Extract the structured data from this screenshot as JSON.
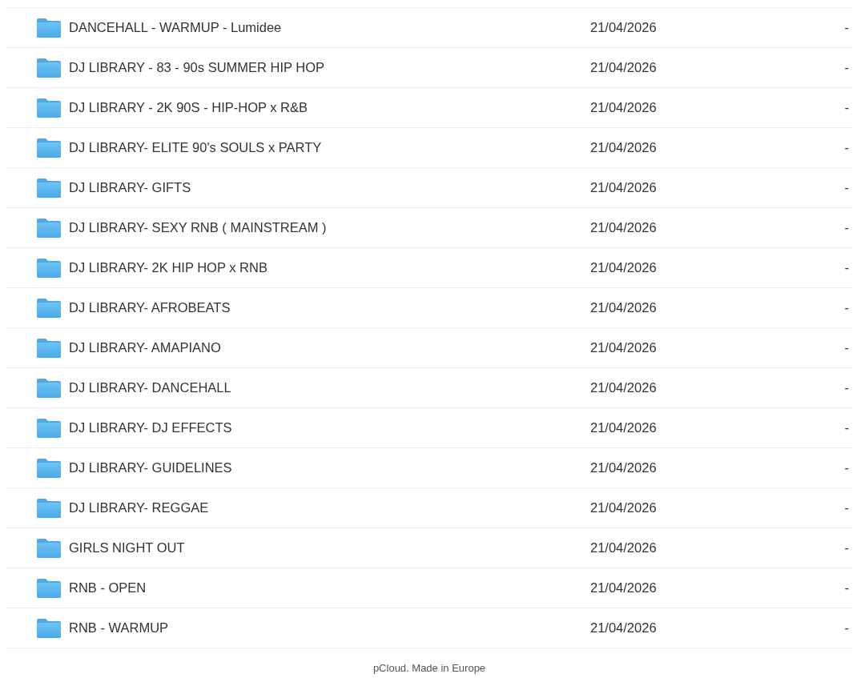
{
  "table": {
    "rows": [
      {
        "name": "DANCEHALL - WARMUP - Lumidee",
        "date": "21/04/2026",
        "column_3": "-"
      },
      {
        "name": "DJ LIBRARY - 83 - 90s SUMMER HIP HOP",
        "date": "21/04/2026",
        "column_3": "-"
      },
      {
        "name": "DJ LIBRARY - 2K 90S - HIP-HOP x R&B",
        "date": "21/04/2026",
        "column_3": "-"
      },
      {
        "name": "DJ LIBRARY- ELITE 90's SOULS x PARTY",
        "date": "21/04/2026",
        "column_3": "-"
      },
      {
        "name": "DJ LIBRARY- GIFTS",
        "date": "21/04/2026",
        "column_3": "-"
      },
      {
        "name": "DJ LIBRARY- SEXY RNB ( MAINSTREAM )",
        "date": "21/04/2026",
        "column_3": "-"
      },
      {
        "name": "DJ LIBRARY- 2K HIP HOP x RNB",
        "date": "21/04/2026",
        "column_3": "-"
      },
      {
        "name": "DJ LIBRARY- AFROBEATS",
        "date": "21/04/2026",
        "column_3": "-"
      },
      {
        "name": "DJ LIBRARY- AMAPIANO",
        "date": "21/04/2026",
        "column_3": "-"
      },
      {
        "name": "DJ LIBRARY- DANCEHALL",
        "date": "21/04/2026",
        "column_3": "-"
      },
      {
        "name": "DJ LIBRARY- DJ EFFECTS",
        "date": "21/04/2026",
        "column_3": "-"
      },
      {
        "name": "DJ LIBRARY- GUIDELINES",
        "date": "21/04/2026",
        "column_3": "-"
      },
      {
        "name": "DJ LIBRARY- REGGAE",
        "date": "21/04/2026",
        "column_3": "-"
      },
      {
        "name": "GIRLS NIGHT OUT",
        "date": "21/04/2026",
        "column_3": "-"
      },
      {
        "name": "RNB - OPEN",
        "date": "21/04/2026",
        "column_3": "-"
      },
      {
        "name": "RNB - WARMUP",
        "date": "21/04/2026",
        "column_3": "-"
      }
    ]
  },
  "footer": {
    "text": "pCloud. Made in Europe"
  }
}
